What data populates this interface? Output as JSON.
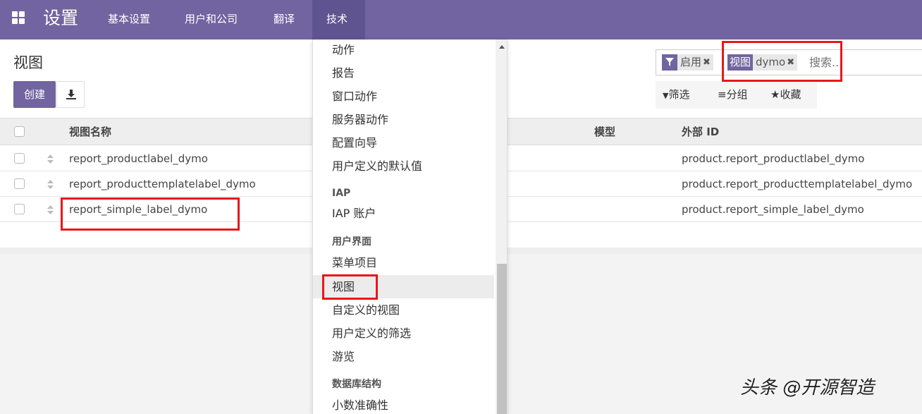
{
  "topbar": {
    "app_title": "设置",
    "menus": [
      "基本设置",
      "用户和公司",
      "翻译",
      "技术"
    ]
  },
  "control_panel": {
    "title": "视图",
    "create_label": "创建",
    "search": {
      "facets": [
        {
          "key_icon": "filter-icon",
          "value": "启用"
        },
        {
          "key": "视图",
          "value": "dymo"
        }
      ],
      "placeholder": "搜索..."
    },
    "search_options": [
      "筛选",
      "分组",
      "收藏"
    ]
  },
  "table": {
    "columns": [
      "视图名称",
      "模型",
      "外部 ID"
    ],
    "rows": [
      {
        "name": "report_productlabel_dymo",
        "external_id": "product.report_productlabel_dymo"
      },
      {
        "name": "report_producttemplatelabel_dymo",
        "external_id": "product.report_producttemplatelabel_dymo"
      },
      {
        "name": "report_simple_label_dymo",
        "external_id": "product.report_simple_label_dymo"
      }
    ]
  },
  "dropdown": {
    "items": [
      {
        "type": "item",
        "label": "动作"
      },
      {
        "type": "item",
        "label": "报告"
      },
      {
        "type": "item",
        "label": "窗口动作"
      },
      {
        "type": "item",
        "label": "服务器动作"
      },
      {
        "type": "item",
        "label": "配置向导"
      },
      {
        "type": "item",
        "label": "用户定义的默认值"
      },
      {
        "type": "header",
        "label": "IAP"
      },
      {
        "type": "item",
        "label": "IAP 账户"
      },
      {
        "type": "header",
        "label": "用户界面"
      },
      {
        "type": "item",
        "label": "菜单项目"
      },
      {
        "type": "item",
        "label": "视图",
        "highlighted": true
      },
      {
        "type": "item",
        "label": "自定义的视图"
      },
      {
        "type": "item",
        "label": "用户定义的筛选"
      },
      {
        "type": "item",
        "label": "游览"
      },
      {
        "type": "header",
        "label": "数据库结构"
      },
      {
        "type": "item",
        "label": "小数准确性"
      }
    ]
  },
  "watermark": "头条 @开源智造",
  "colors": {
    "brand": "#7164a0",
    "highlight_border": "#e8171a"
  }
}
